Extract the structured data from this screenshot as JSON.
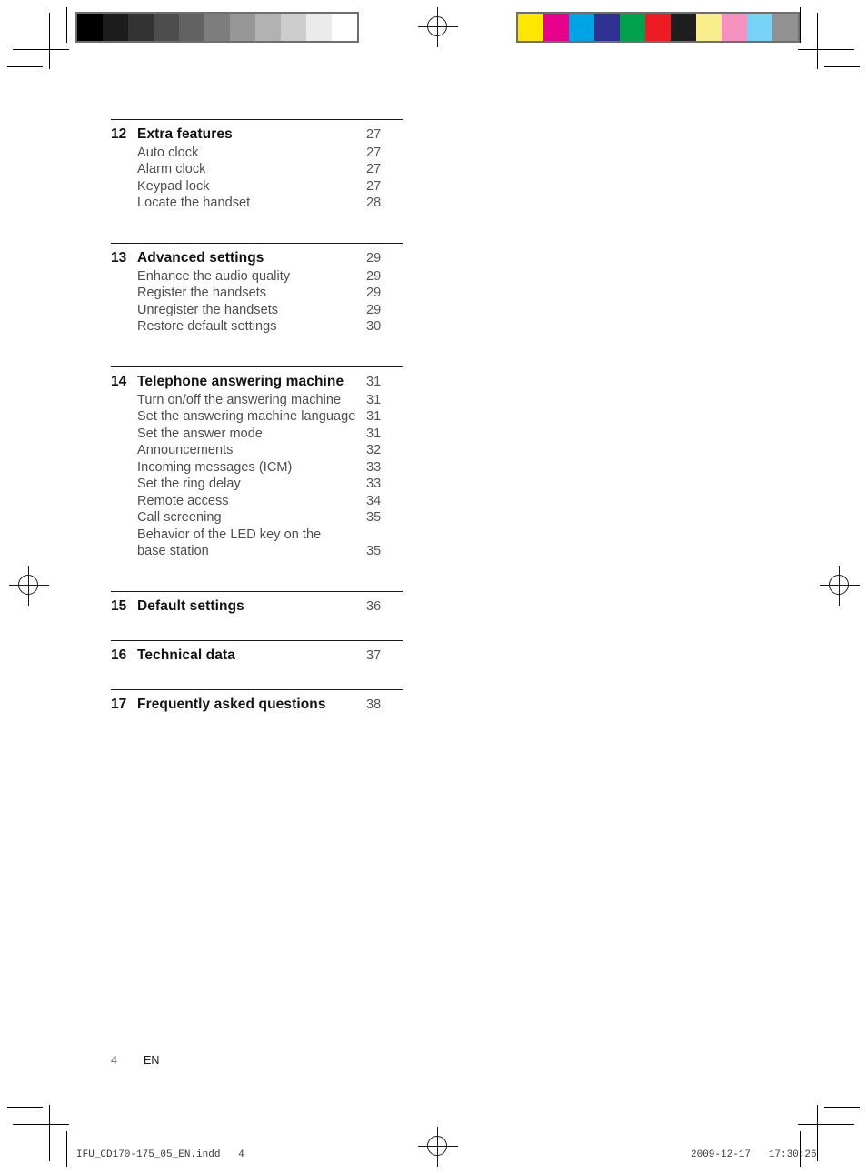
{
  "document": {
    "footer": {
      "page_number": "4",
      "language": "EN"
    },
    "slug_left": "IFU_CD170-175_05_EN.indd   4",
    "slug_right": "2009-12-17   17:30:26"
  },
  "calibration": {
    "grayscale_label": "grayscale-calibration-strip",
    "grayscale_swatches": [
      "#000000",
      "#1c1c1c",
      "#333333",
      "#4d4d4d",
      "#626262",
      "#7d7d7d",
      "#969696",
      "#b2b2b2",
      "#cdcdcd",
      "#ebebeb",
      "#ffffff"
    ],
    "color_label": "color-calibration-strip",
    "color_swatches": [
      "#fde700",
      "#e6008c",
      "#00a4e4",
      "#2e3192",
      "#00a14b",
      "#ed1c24",
      "#1e1e1e",
      "#faee8c",
      "#f590c1",
      "#77d3f5",
      "#919191"
    ]
  },
  "toc": {
    "sections": [
      {
        "number": "12",
        "title": "Extra features",
        "page": "27",
        "entries": [
          {
            "label": "Auto clock",
            "page": "27"
          },
          {
            "label": "Alarm clock",
            "page": "27"
          },
          {
            "label": "Keypad lock",
            "page": "27"
          },
          {
            "label": "Locate the handset",
            "page": "28"
          }
        ]
      },
      {
        "number": "13",
        "title": "Advanced settings",
        "page": "29",
        "entries": [
          {
            "label": "Enhance the audio quality",
            "page": "29"
          },
          {
            "label": "Register the handsets",
            "page": "29"
          },
          {
            "label": "Unregister the handsets",
            "page": "29"
          },
          {
            "label": "Restore default settings",
            "page": "30"
          }
        ]
      },
      {
        "number": "14",
        "title": "Telephone answering machine",
        "page": "31",
        "entries": [
          {
            "label": "Turn on/off the answering machine",
            "page": "31"
          },
          {
            "label": "Set the answering machine language",
            "page": "31"
          },
          {
            "label": "Set the answer mode",
            "page": "31"
          },
          {
            "label": "Announcements",
            "page": "32"
          },
          {
            "label": "Incoming messages (ICM)",
            "page": "33"
          },
          {
            "label": "Set the ring delay",
            "page": "33"
          },
          {
            "label": "Remote access",
            "page": "34"
          },
          {
            "label": "Call screening",
            "page": "35"
          },
          {
            "label": "Behavior of the LED key on the",
            "page": ""
          },
          {
            "label": "base station",
            "page": "35"
          }
        ]
      },
      {
        "number": "15",
        "title": "Default settings",
        "page": "36",
        "entries": []
      },
      {
        "number": "16",
        "title": "Technical data",
        "page": "37",
        "entries": []
      },
      {
        "number": "17",
        "title": "Frequently asked questions",
        "page": "38",
        "entries": []
      }
    ]
  }
}
